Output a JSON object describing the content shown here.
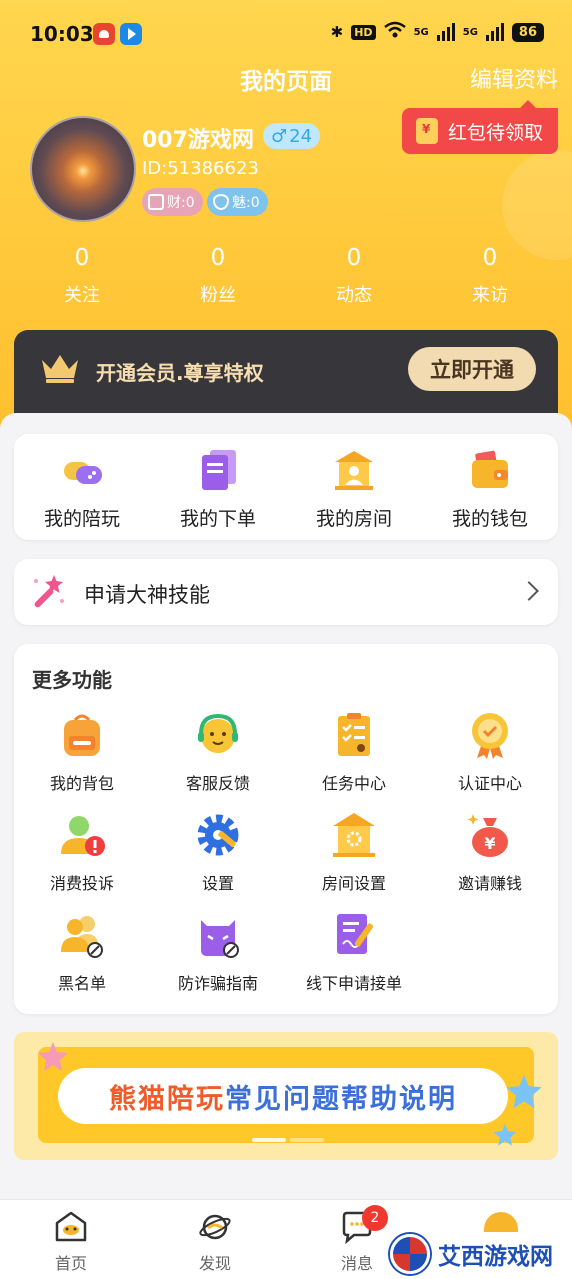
{
  "status_bar": {
    "time": "10:03",
    "hd_label": "HD",
    "network1": "5G",
    "network2": "5G",
    "battery": "86"
  },
  "header": {
    "title": "我的页面",
    "edit_profile": "编辑资料",
    "red_packet_label": "红包待领取"
  },
  "profile": {
    "name": "007游戏网",
    "gender_symbol": "♂",
    "age": "24",
    "id_text": "ID:51386623",
    "wealth_tag": "财:0",
    "charm_tag": "魅:0"
  },
  "stats": [
    {
      "value": "0",
      "label": "关注"
    },
    {
      "value": "0",
      "label": "粉丝"
    },
    {
      "value": "0",
      "label": "动态"
    },
    {
      "value": "0",
      "label": "来访"
    }
  ],
  "vip": {
    "text": "开通会员.尊享特权",
    "button": "立即开通"
  },
  "quick_actions": [
    {
      "label": "我的陪玩",
      "icon": "gamepad-icon"
    },
    {
      "label": "我的下单",
      "icon": "orders-icon"
    },
    {
      "label": "我的房间",
      "icon": "room-icon"
    },
    {
      "label": "我的钱包",
      "icon": "wallet-icon"
    }
  ],
  "apply_skill": {
    "label": "申请大神技能"
  },
  "more": {
    "title": "更多功能",
    "items": [
      {
        "label": "我的背包",
        "icon": "backpack-icon"
      },
      {
        "label": "客服反馈",
        "icon": "customer-service-icon"
      },
      {
        "label": "任务中心",
        "icon": "task-icon"
      },
      {
        "label": "认证中心",
        "icon": "certification-icon"
      },
      {
        "label": "消费投诉",
        "icon": "complaint-icon"
      },
      {
        "label": "设置",
        "icon": "settings-gear-icon"
      },
      {
        "label": "房间设置",
        "icon": "room-settings-icon"
      },
      {
        "label": "邀请赚钱",
        "icon": "money-bag-icon"
      },
      {
        "label": "黑名单",
        "icon": "blacklist-icon"
      },
      {
        "label": "防诈骗指南",
        "icon": "anti-fraud-icon"
      },
      {
        "label": "线下申请接单",
        "icon": "offline-apply-icon"
      }
    ]
  },
  "help_banner": {
    "text_part1": "熊猫陪玩",
    "text_part2": "常见问题帮助说明"
  },
  "tabbar": {
    "tabs": [
      {
        "label": "首页",
        "icon": "home-icon"
      },
      {
        "label": "发现",
        "icon": "discover-icon"
      },
      {
        "label": "消息",
        "icon": "message-icon"
      }
    ],
    "message_badge": "2"
  },
  "watermark": {
    "text": "艾西游戏网"
  },
  "colors": {
    "header_yellow": "#ffc93b",
    "vip_dark": "#37363b",
    "vip_gold": "#f2dbb1",
    "red_accent": "#f24848",
    "badge_red": "#f2372f"
  }
}
